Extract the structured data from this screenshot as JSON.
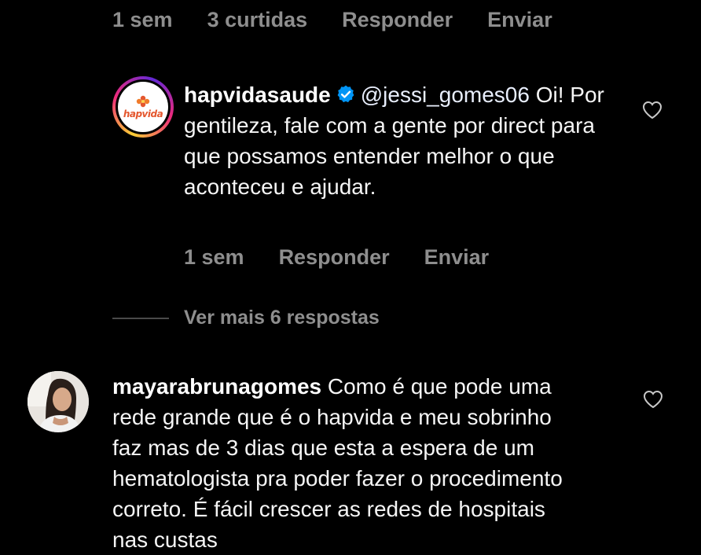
{
  "top_meta": {
    "time": "1 sem",
    "likes": "3 curtidas",
    "reply": "Responder",
    "send": "Enviar"
  },
  "reply": {
    "username": "hapvidasaude",
    "avatar_logo_text": "hapvida",
    "mention": "@jessi_gomes06",
    "text": "Oi! Por gentileza, fale com a gente por direct para que possamos entender melhor o que aconteceu e ajudar.",
    "time": "1 sem",
    "reply_label": "Responder",
    "send_label": "Enviar",
    "verified_icon": "verified-badge-icon",
    "like_icon": "heart-outline-icon"
  },
  "view_more": {
    "label": "Ver mais 6 respostas"
  },
  "comment": {
    "username": "mayarabrunagomes",
    "text": "Como é que pode uma rede grande que é o hapvida e meu sobrinho faz mas de 3 dias que esta a espera de um hematologista pra poder fazer o procedimento correto. É fácil crescer as redes de hospitais nas custas",
    "like_icon": "heart-outline-icon"
  },
  "colors": {
    "background": "#000000",
    "text": "#f5f5f5",
    "muted": "#8e8e8e",
    "verified": "#0095f6",
    "brand_orange": "#e4572e"
  }
}
